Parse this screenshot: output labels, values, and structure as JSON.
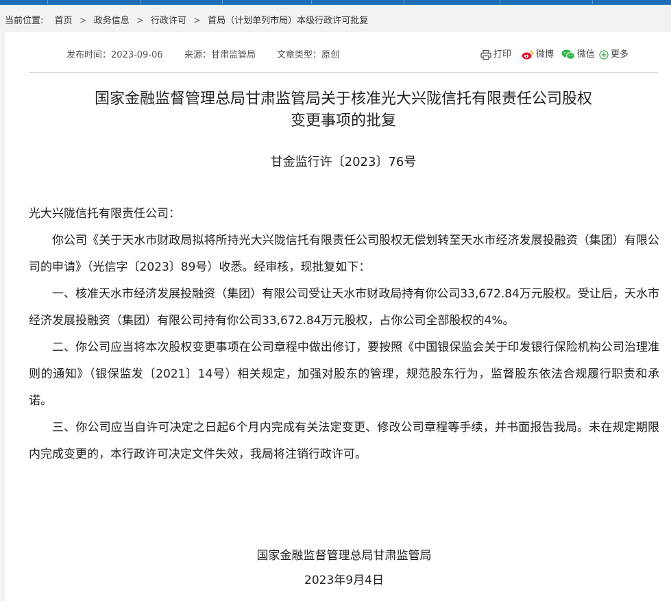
{
  "breadcrumb": {
    "prefix": "当前位置:",
    "items": [
      "首页",
      "政务信息",
      "行政许可",
      "首局（计划单列市局）本级行政许可批复"
    ],
    "separator": ">"
  },
  "meta": {
    "publish_date": "发布时间：2023-09-06",
    "source": "来源：甘肃监管局",
    "doc_type": "文章类型：原创"
  },
  "share": {
    "print": "打印",
    "weibo": "微博",
    "wechat": "微信",
    "more": "更多"
  },
  "article": {
    "title_line1": "国家金融监督管理总局甘肃监管局关于核准光大兴陇信托有限责任公司股权",
    "title_line2": "变更事项的批复",
    "doc_number": "甘金监行许〔2023〕76号",
    "salutation": "光大兴陇信托有限责任公司：",
    "paragraphs": [
      "你公司《关于天水市财政局拟将所持光大兴陇信托有限责任公司股权无偿划转至天水市经济发展投融资（集团）有限公司的申请》（光信字〔2023〕89号）收悉。经审核，现批复如下：",
      "一、核准天水市经济发展投融资（集团）有限公司受让天水市财政局持有你公司33,672.84万元股权。受让后，天水市经济发展投融资（集团）有限公司持有你公司33,672.84万元股权，占你公司全部股权的4%。",
      "二、你公司应当将本次股权变更事项在公司章程中做出修订，要按照《中国银保监会关于印发银行保险机构公司治理准则的通知》（银保监发〔2021〕14号）相关规定，加强对股东的管理，规范股东行为，监督股东依法合规履行职责和承诺。",
      "三、你公司应当自许可决定之日起6个月内完成有关法定变更、修改公司章程等手续，并书面报告我局。未在规定期限内完成变更的，本行政许可决定文件失效，我局将注销行政许可。"
    ],
    "signature_org": "国家金融监督管理总局甘肃监管局",
    "signature_date": "2023年9月4日"
  },
  "colors": {
    "nav": "#1f6fb8",
    "weibo": "#e6162d",
    "wechat": "#2db84d",
    "more": "#3fae49"
  }
}
